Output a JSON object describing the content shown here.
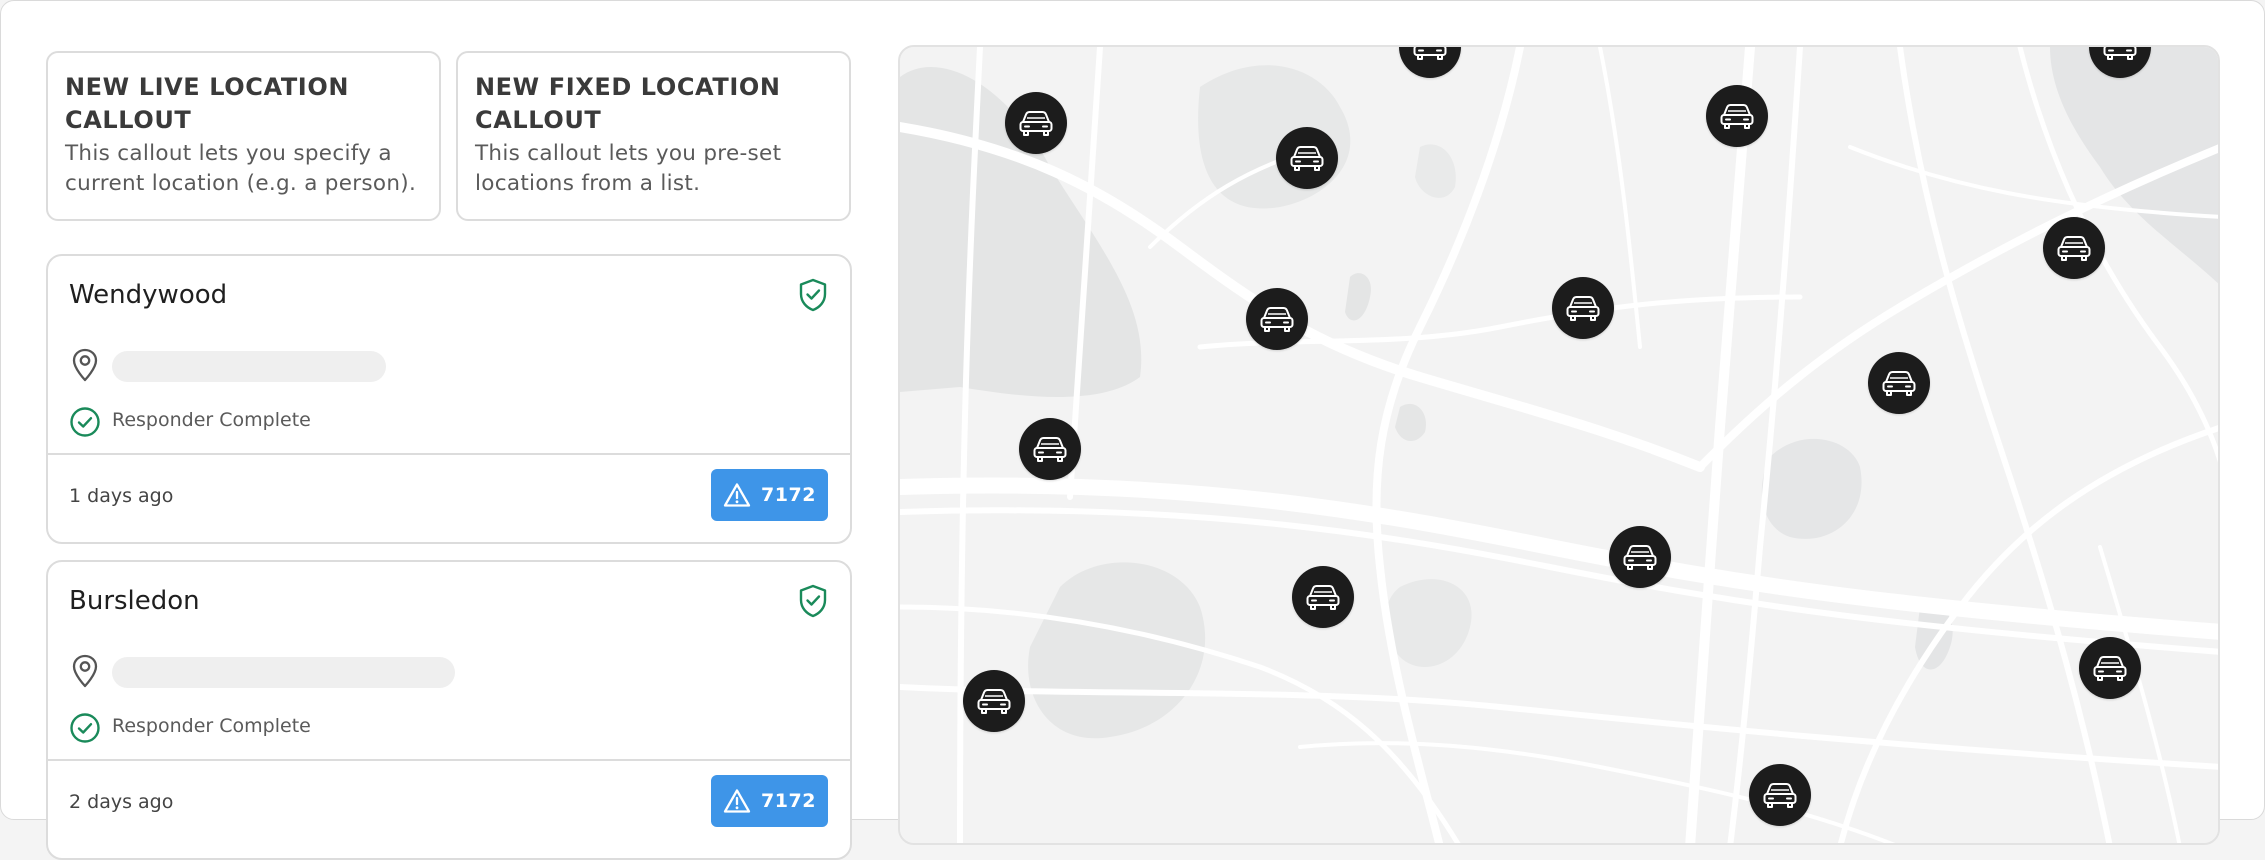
{
  "callouts": {
    "live": {
      "title": "NEW LIVE LOCATION CALLOUT",
      "description": "This callout lets you specify a current location (e.g. a person)."
    },
    "fixed": {
      "title": "NEW FIXED LOCATION CALLOUT",
      "description": "This callout lets you pre-set locations from a list."
    }
  },
  "incidents": [
    {
      "name": "Wendywood",
      "status": "Responder Complete",
      "time_ago": "1 days ago",
      "alert_count": "7172",
      "shield_icon": "shield-check-icon",
      "status_icon": "check-circle-icon"
    },
    {
      "name": "Bursledon",
      "status": "Responder Complete",
      "time_ago": "2 days ago",
      "alert_count": "7172",
      "shield_icon": "shield-check-icon",
      "status_icon": "check-circle-icon"
    }
  ],
  "map": {
    "marker_icon": "car-icon",
    "marker_count": 15
  },
  "colors": {
    "accent_blue": "#3e95e8",
    "success_green": "#1a8a5a",
    "marker_dark": "#1c1c1c"
  }
}
